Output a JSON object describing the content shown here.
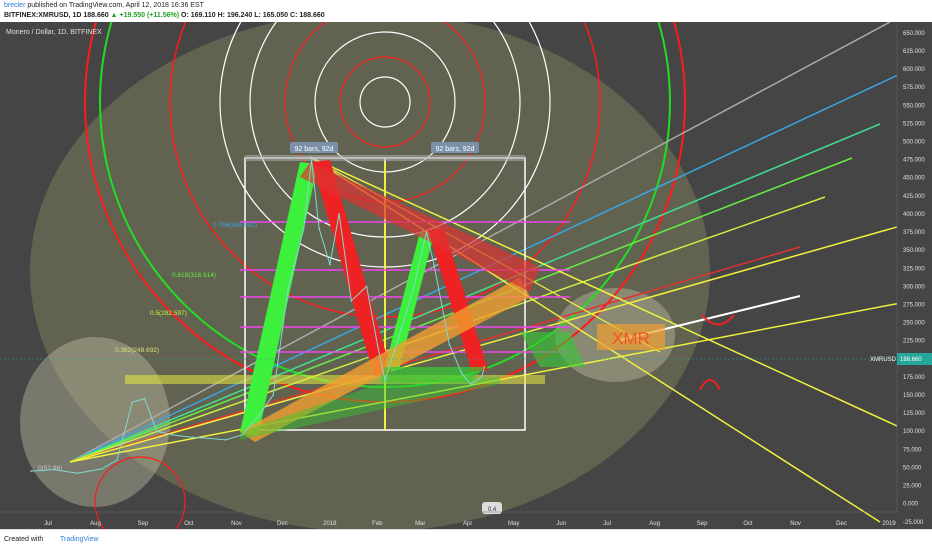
{
  "header": {
    "author": "brecler",
    "published": "published on TradingView.com, April 12, 2018 16:36 EST",
    "symbol": "BITFINEX:XMRUSD, 1D",
    "price": "188.660",
    "change": "+19.550 (+11.56%)",
    "open": "O: 169.110",
    "high": "H: 196.240",
    "low": "L: 165.050",
    "close": "C: 188.660"
  },
  "footer": {
    "created": "Created with",
    "brand": "TradingView"
  },
  "colors": {
    "background": "#454545",
    "green_arrow": "#3cf03c",
    "red_arrow": "#ee2222",
    "orange_band": "#f0a030",
    "yellow": "#f0f040",
    "white": "#ffffff",
    "circle_fill": "#b0b070"
  },
  "chart_data": {
    "type": "line",
    "title": "Monero / Dollar, 1D, BITFINEX",
    "current_price_tag": "XMRUSD",
    "current_price": "188.660",
    "x_ticks": [
      "Jul",
      "Aug",
      "Sep",
      "Oct",
      "Nov",
      "Dec",
      "2018",
      "Feb",
      "Mar",
      "Apr",
      "May",
      "Jun",
      "Jul",
      "Aug",
      "Sep",
      "Oct",
      "Nov",
      "Dec",
      "2019"
    ],
    "y_ticks": [
      650,
      625,
      600,
      575,
      550,
      525,
      500,
      475,
      450,
      425,
      400,
      375,
      350,
      325,
      300,
      275,
      250,
      225,
      200,
      175,
      150,
      125,
      100,
      75,
      50,
      25,
      0,
      -25
    ],
    "y_tick_labels": [
      "650.000",
      "625.000",
      "600.000",
      "575.000",
      "550.000",
      "525.000",
      "500.000",
      "475.000",
      "450.000",
      "425.000",
      "400.000",
      "375.000",
      "350.000",
      "325.000",
      "300.000",
      "275.000",
      "250.000",
      "225.000",
      "200.000",
      "175.000",
      "150.000",
      "125.000",
      "100.000",
      "75.000",
      "50.000",
      "25.000",
      "0.000",
      "-25.000"
    ],
    "ylim": [
      -35,
      665
    ],
    "series": [
      {
        "points": [
          [
            "2017-06-20",
            45
          ],
          [
            "2017-07-05",
            47
          ],
          [
            "2017-07-20",
            42
          ],
          [
            "2017-08-05",
            48
          ],
          [
            "2017-08-15",
            60
          ],
          [
            "2017-08-25",
            140
          ],
          [
            "2017-09-02",
            145
          ],
          [
            "2017-09-10",
            100
          ],
          [
            "2017-09-20",
            95
          ],
          [
            "2017-10-01",
            92
          ],
          [
            "2017-10-15",
            90
          ],
          [
            "2017-10-25",
            88
          ],
          [
            "2017-11-05",
            95
          ],
          [
            "2017-11-15",
            120
          ],
          [
            "2017-11-25",
            150
          ],
          [
            "2017-12-05",
            300
          ],
          [
            "2017-12-15",
            380
          ],
          [
            "2017-12-20",
            475
          ],
          [
            "2017-12-25",
            380
          ],
          [
            "2018-01-01",
            330
          ],
          [
            "2018-01-07",
            400
          ],
          [
            "2018-01-15",
            280
          ],
          [
            "2018-01-25",
            300
          ],
          [
            "2018-02-01",
            220
          ],
          [
            "2018-02-06",
            170
          ],
          [
            "2018-02-15",
            230
          ],
          [
            "2018-02-25",
            300
          ],
          [
            "2018-03-05",
            375
          ],
          [
            "2018-03-10",
            330
          ],
          [
            "2018-03-20",
            220
          ],
          [
            "2018-03-28",
            180
          ],
          [
            "2018-04-03",
            165
          ],
          [
            "2018-04-10",
            175
          ],
          [
            "2018-04-12",
            188.66
          ]
        ]
      }
    ],
    "annotations": {
      "bars_labels": [
        "92 bars, 92d",
        "92 bars, 92d"
      ],
      "fib_labels": [
        "0.786(366.882)",
        "0.618(316.614)",
        "0.5(282.597)",
        "0.382(248.692)",
        "0(52.98)"
      ],
      "watermark": "XMR",
      "flag": "0.4"
    },
    "grid": false
  }
}
